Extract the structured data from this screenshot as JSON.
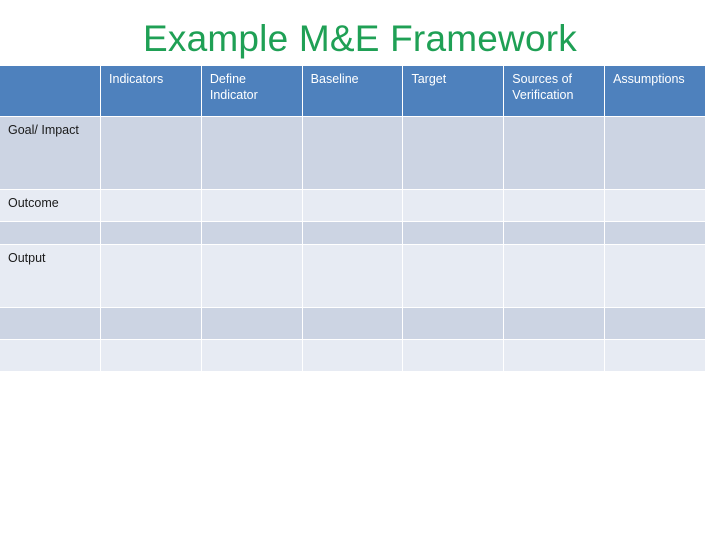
{
  "slide": {
    "title": "Example M&E Framework",
    "title_color": "#1fa055",
    "background": "#ffffff"
  },
  "table": {
    "header_bg": "#4e81bd",
    "header_text_color": "#ffffff",
    "row_dark_bg": "#ccd4e3",
    "row_light_bg": "#e7ebf3",
    "gridline_color": "#ffffff",
    "columns": [
      {
        "label": ""
      },
      {
        "label": "Indicators"
      },
      {
        "label": "Define Indicator"
      },
      {
        "label": "Baseline"
      },
      {
        "label": "Target"
      },
      {
        "label": "Sources of Verification"
      },
      {
        "label": "Assumptions"
      }
    ],
    "rows": [
      {
        "label": "Goal/ Impact",
        "shade": "dark",
        "cells": [
          "",
          "",
          "",
          "",
          "",
          ""
        ]
      },
      {
        "label": "Outcome",
        "shade": "light",
        "cells": [
          "",
          "",
          "",
          "",
          "",
          ""
        ]
      },
      {
        "label": "",
        "shade": "dark",
        "cells": [
          "",
          "",
          "",
          "",
          "",
          ""
        ]
      },
      {
        "label": "Output",
        "shade": "light",
        "cells": [
          "",
          "",
          "",
          "",
          "",
          ""
        ]
      },
      {
        "label": "",
        "shade": "dark",
        "cells": [
          "",
          "",
          "",
          "",
          "",
          ""
        ]
      },
      {
        "label": "",
        "shade": "light",
        "cells": [
          "",
          "",
          "",
          "",
          "",
          ""
        ]
      }
    ]
  }
}
